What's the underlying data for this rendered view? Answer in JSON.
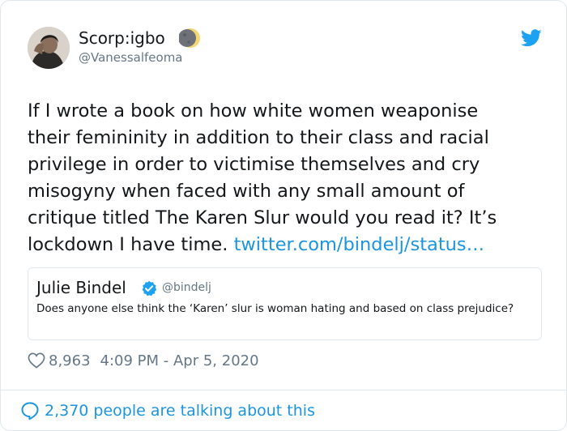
{
  "author": {
    "display_name": "Scorp:igbo",
    "handle": "@Vanessalfeoma"
  },
  "tweet": {
    "text": "If I wrote a book on how white women weaponise\ntheir femininity in addition to their class and racial\nprivilege in order to victimise themselves and cry\nmisogyny when faced with any small amount of\ncritique titled The Karen Slur would you read it? It’s\nlockdown I have time. ",
    "link": "twitter.com/bindelj/status…"
  },
  "quoted_tweet": {
    "name": "Julie Bindel",
    "handle": "@bindelj",
    "text": "Does anyone else think the ‘Karen’ slur  is woman hating and based on class prejudice?"
  },
  "meta": {
    "likes": "8,963",
    "timestamp": "4:09 PM - Apr 5, 2020"
  },
  "footer": {
    "talking": "2,370 people are talking about this"
  },
  "icons": {
    "moon": "crescent-moon-emoji-icon",
    "brand": "twitter-bird-icon",
    "verified": "verified-badge-icon",
    "like": "heart-icon",
    "reply": "speech-bubble-icon"
  },
  "colors": {
    "brand_blue": "#1da1f2",
    "link_blue": "#1b95e0",
    "secondary_text": "#657786",
    "border": "#e1e8ed"
  }
}
